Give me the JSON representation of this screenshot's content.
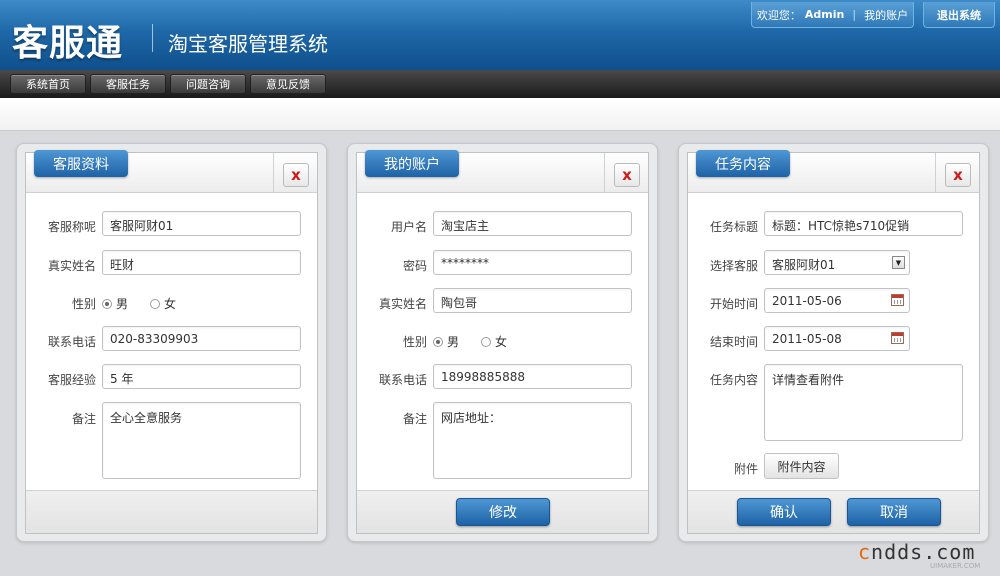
{
  "header": {
    "logo": "客服通",
    "system_name": "淘宝客服管理系统",
    "welcome": "欢迎您：",
    "username": "Admin",
    "separator": "|",
    "my_account": "我的账户",
    "logout": "退出系统"
  },
  "nav": {
    "items": [
      {
        "label": "系统首页"
      },
      {
        "label": "客服任务"
      },
      {
        "label": "问题咨询"
      },
      {
        "label": "意见反馈"
      }
    ]
  },
  "panels": {
    "profile": {
      "title": "客服资料",
      "close": "x",
      "fields": {
        "nickname": {
          "label": "客服称呢",
          "value": "客服阿财01"
        },
        "realname": {
          "label": "真实姓名",
          "value": "旺财"
        },
        "gender": {
          "label": "性别",
          "male": "男",
          "female": "女",
          "selected": "男"
        },
        "phone": {
          "label": "联系电话",
          "value": "020-83309903"
        },
        "experience": {
          "label": "客服经验",
          "value": "5 年"
        },
        "notes": {
          "label": "备注",
          "value": "全心全意服务"
        }
      }
    },
    "account": {
      "title": "我的账户",
      "close": "x",
      "fields": {
        "username": {
          "label": "用户名",
          "value": "淘宝店主"
        },
        "password": {
          "label": "密码",
          "value": "********"
        },
        "realname": {
          "label": "真实姓名",
          "value": "陶包哥"
        },
        "gender": {
          "label": "性别",
          "male": "男",
          "female": "女",
          "selected": "男"
        },
        "phone": {
          "label": "联系电话",
          "value": "18998885888"
        },
        "notes": {
          "label": "备注",
          "value": "网店地址："
        }
      },
      "modify_button": "修改"
    },
    "task": {
      "title": "任务内容",
      "close": "x",
      "fields": {
        "task_title": {
          "label": "任务标题",
          "value": "标题：HTC惊艳s710促销"
        },
        "agent": {
          "label": "选择客服",
          "value": "客服阿财01"
        },
        "start": {
          "label": "开始时间",
          "value": "2011-05-06"
        },
        "end": {
          "label": "结束时间",
          "value": "2011-05-08"
        },
        "content": {
          "label": "任务内容",
          "value": "详情查看附件"
        },
        "attachment": {
          "label": "附件",
          "button": "附件内容"
        }
      },
      "confirm_button": "确认",
      "cancel_button": "取消"
    }
  },
  "watermark": {
    "c": "c",
    "rest": "ndds.com",
    "sub": "UIMAKER.COM"
  },
  "colors": {
    "accent": "#1d62a6",
    "close": "#cc1b1b",
    "nav": "#1a1a1a"
  }
}
